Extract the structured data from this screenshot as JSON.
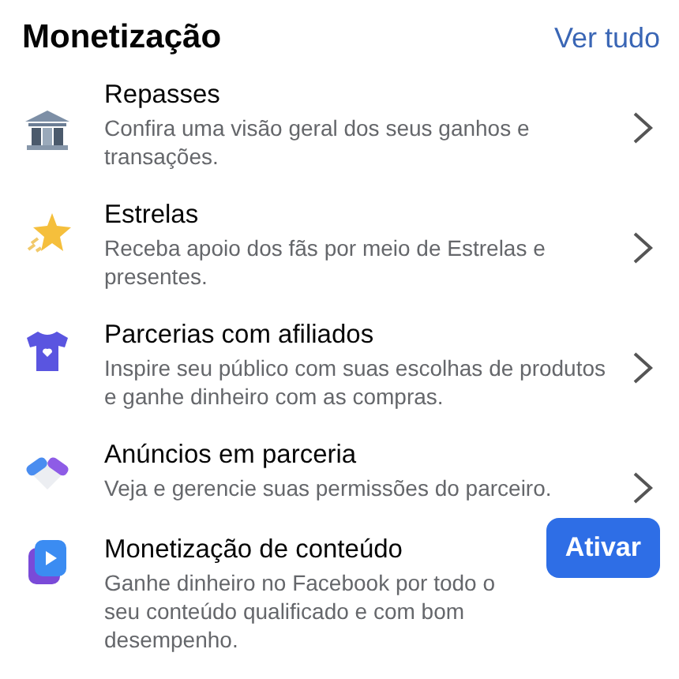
{
  "header": {
    "title": "Monetização",
    "link": "Ver tudo"
  },
  "items": [
    {
      "kind": "chevron",
      "title": "Repasses",
      "description": "Confira uma visão geral dos seus ganhos e transações."
    },
    {
      "kind": "chevron",
      "title": "Estrelas",
      "description": "Receba apoio dos fãs por meio de Estrelas e presentes."
    },
    {
      "kind": "chevron",
      "title": "Parcerias com afiliados",
      "description": "Inspire seu público com suas escolhas de produtos e ganhe dinheiro com as compras."
    },
    {
      "kind": "chevron",
      "title": "Anúncios em parceria",
      "description": "Veja e gerencie suas permissões do parceiro."
    },
    {
      "kind": "button",
      "title": "Monetização de conteúdo",
      "description": "Ganhe dinheiro no Facebook por todo o seu conteúdo qualificado e com bom desempenho.",
      "button": "Ativar"
    }
  ]
}
